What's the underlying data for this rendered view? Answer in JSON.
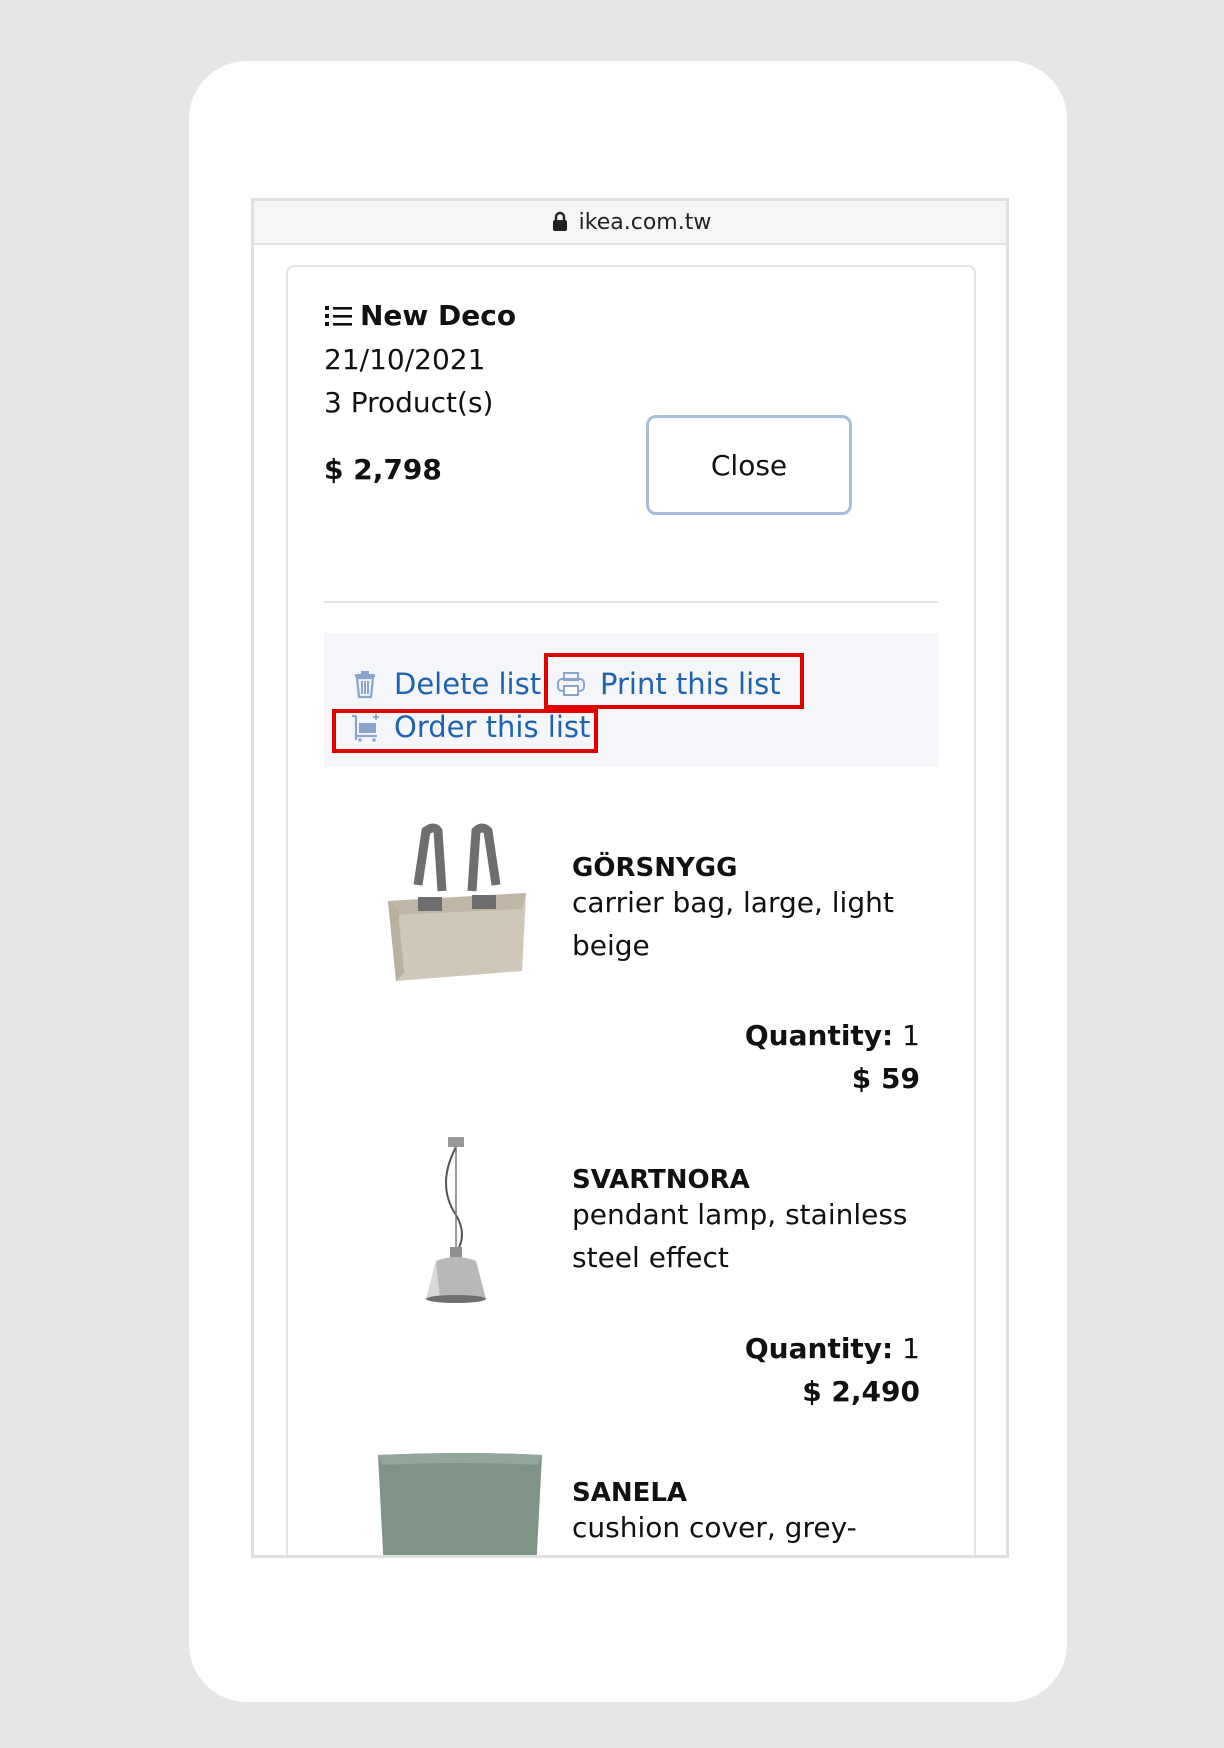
{
  "browser": {
    "url": "ikea.com.tw"
  },
  "list": {
    "title": "New Deco",
    "date": "21/10/2021",
    "product_count": "3 Product(s)",
    "total": "$ 2,798",
    "close_label": "Close"
  },
  "actions": {
    "delete_label": "Delete list",
    "print_label": "Print this list",
    "order_label": "Order this list"
  },
  "products": [
    {
      "name": "GÖRSNYGG",
      "desc_line1": "carrier bag, large, light",
      "desc_line2": "beige",
      "quantity_label": "Quantity:",
      "quantity": "1",
      "price": "$ 59"
    },
    {
      "name": "SVARTNORA",
      "desc_line1": "pendant lamp, stainless",
      "desc_line2": "steel effect",
      "quantity_label": "Quantity:",
      "quantity": "1",
      "price": "$ 2,490"
    },
    {
      "name": "SANELA",
      "desc_line1": "cushion cover, grey-"
    }
  ],
  "colors": {
    "link": "#1f62b0",
    "highlight": "#e00000",
    "close_border": "#a9bde0"
  }
}
